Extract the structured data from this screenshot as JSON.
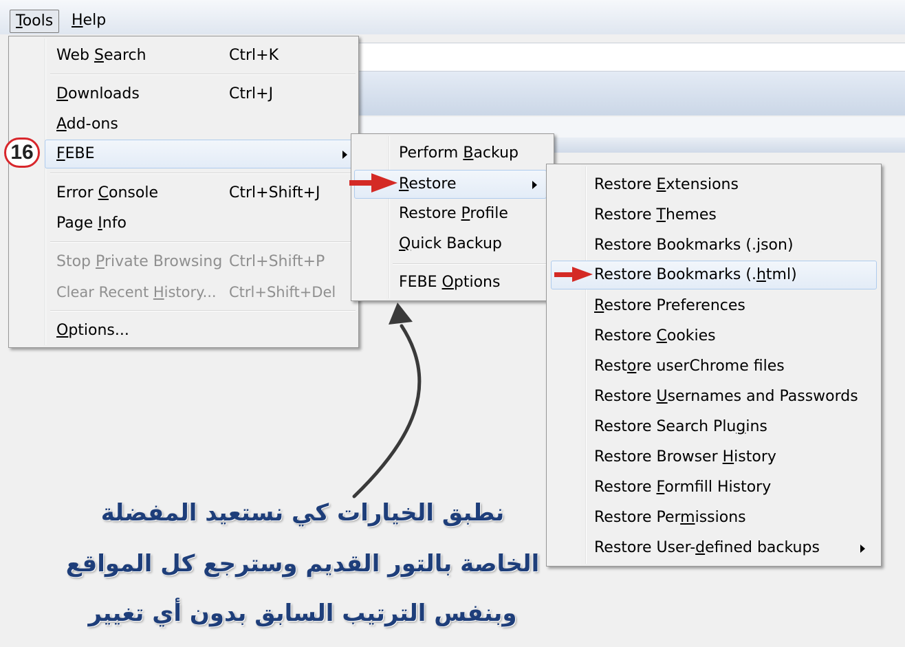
{
  "menubar": {
    "items": [
      {
        "label_pre": "",
        "label_u": "T",
        "label_post": "ools"
      },
      {
        "label_pre": "",
        "label_u": "H",
        "label_post": "elp"
      }
    ]
  },
  "tools_menu": {
    "items": [
      {
        "pre": "Web ",
        "u": "S",
        "post": "earch",
        "accel": "Ctrl+K",
        "disabled": false
      },
      {
        "pre": "",
        "u": "D",
        "post": "ownloads",
        "accel": "Ctrl+J",
        "disabled": false
      },
      {
        "pre": "",
        "u": "A",
        "post": "dd-ons",
        "accel": "",
        "disabled": false
      },
      {
        "pre": "",
        "u": "F",
        "post": "EBE",
        "accel": "",
        "disabled": false
      },
      {
        "pre": "Error ",
        "u": "C",
        "post": "onsole",
        "accel": "Ctrl+Shift+J",
        "disabled": false
      },
      {
        "pre": "Page ",
        "u": "I",
        "post": "nfo",
        "accel": "",
        "disabled": false
      },
      {
        "pre": "Stop ",
        "u": "P",
        "post": "rivate Browsing",
        "accel": "Ctrl+Shift+P",
        "disabled": true
      },
      {
        "pre": "Clear Recent ",
        "u": "H",
        "post": "istory...",
        "accel": "Ctrl+Shift+Del",
        "disabled": true
      },
      {
        "pre": "",
        "u": "O",
        "post": "ptions...",
        "accel": "",
        "disabled": false
      }
    ]
  },
  "febe_menu": {
    "items": [
      {
        "pre": "Perform ",
        "u": "B",
        "post": "ackup"
      },
      {
        "pre": "",
        "u": "R",
        "post": "estore"
      },
      {
        "pre": "Restore ",
        "u": "P",
        "post": "rofile"
      },
      {
        "pre": "",
        "u": "Q",
        "post": "uick Backup"
      },
      {
        "pre": "FEBE ",
        "u": "O",
        "post": "ptions"
      }
    ]
  },
  "restore_menu": {
    "items": [
      {
        "pre": "Restore ",
        "u": "E",
        "post": "xtensions"
      },
      {
        "pre": "Restore ",
        "u": "T",
        "post": "hemes"
      },
      {
        "pre": "Restore Bookmarks (.",
        "u": "j",
        "post": "son)"
      },
      {
        "pre": "Restore Bookmarks (.",
        "u": "h",
        "post": "tml)"
      },
      {
        "pre": "",
        "u": "R",
        "post": "estore Preferences"
      },
      {
        "pre": "Restore ",
        "u": "C",
        "post": "ookies"
      },
      {
        "pre": "Rest",
        "u": "o",
        "post": "re userChrome files"
      },
      {
        "pre": "Restore ",
        "u": "U",
        "post": "sernames and Passwords"
      },
      {
        "pre": "Restore Search Plu",
        "u": "g",
        "post": "ins"
      },
      {
        "pre": "Restore Browser ",
        "u": "H",
        "post": "istory"
      },
      {
        "pre": "Restore ",
        "u": "F",
        "post": "ormfill History"
      },
      {
        "pre": "Restore Per",
        "u": "m",
        "post": "issions"
      },
      {
        "pre": "Restore User-",
        "u": "d",
        "post": "efined backups"
      }
    ]
  },
  "annotation": {
    "step_number": "16",
    "caption_lines": [
      "نطبق الخيارات كي نستعيد المفضلة",
      "الخاصة بالتور القديم وسترجع كل المواقع",
      "وبنفس الترتيب السابق بدون أي تغيير"
    ],
    "arrow_color": "#d42a25",
    "curved_arrow_color": "#3a3a3a",
    "caption_color": "#1e3e7a"
  }
}
